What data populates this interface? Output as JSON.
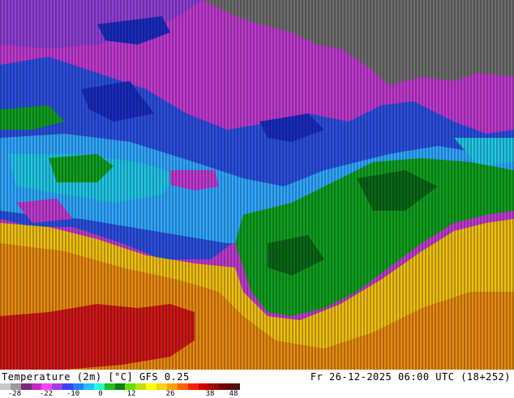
{
  "map": {
    "title": "Temperature (2m) [°C] GFS 0.25",
    "valid_time": "Fr 26-12-2025 06:00 UTC (18+252)"
  },
  "legend": {
    "ticks": [
      "-28",
      "-22",
      "-10",
      "0",
      "12",
      "26",
      "38",
      "48"
    ],
    "colors": [
      "#c8c8c8",
      "#9a9a9a",
      "#7a2a7a",
      "#c02ac0",
      "#ff40ff",
      "#a040e0",
      "#4040ff",
      "#2080ff",
      "#20c0ff",
      "#20ffd0",
      "#20c020",
      "#108010",
      "#60e000",
      "#c0e000",
      "#ffff00",
      "#ffd000",
      "#ffa000",
      "#ff6000",
      "#ff2000",
      "#d00000",
      "#a00000",
      "#700000",
      "#501010"
    ]
  },
  "regions": {
    "palette": {
      "gray": "#6e6e6e",
      "magenta": "#c03ad0",
      "violet": "#9040d8",
      "blue": "#2a50e0",
      "deepblue": "#1a2cc0",
      "lightblue": "#30a8ff",
      "cyan": "#20c8e8",
      "green": "#10a020",
      "darkgreen": "#086818",
      "yellow": "#f0c010",
      "orange": "#e88a10",
      "red": "#d01818"
    }
  }
}
